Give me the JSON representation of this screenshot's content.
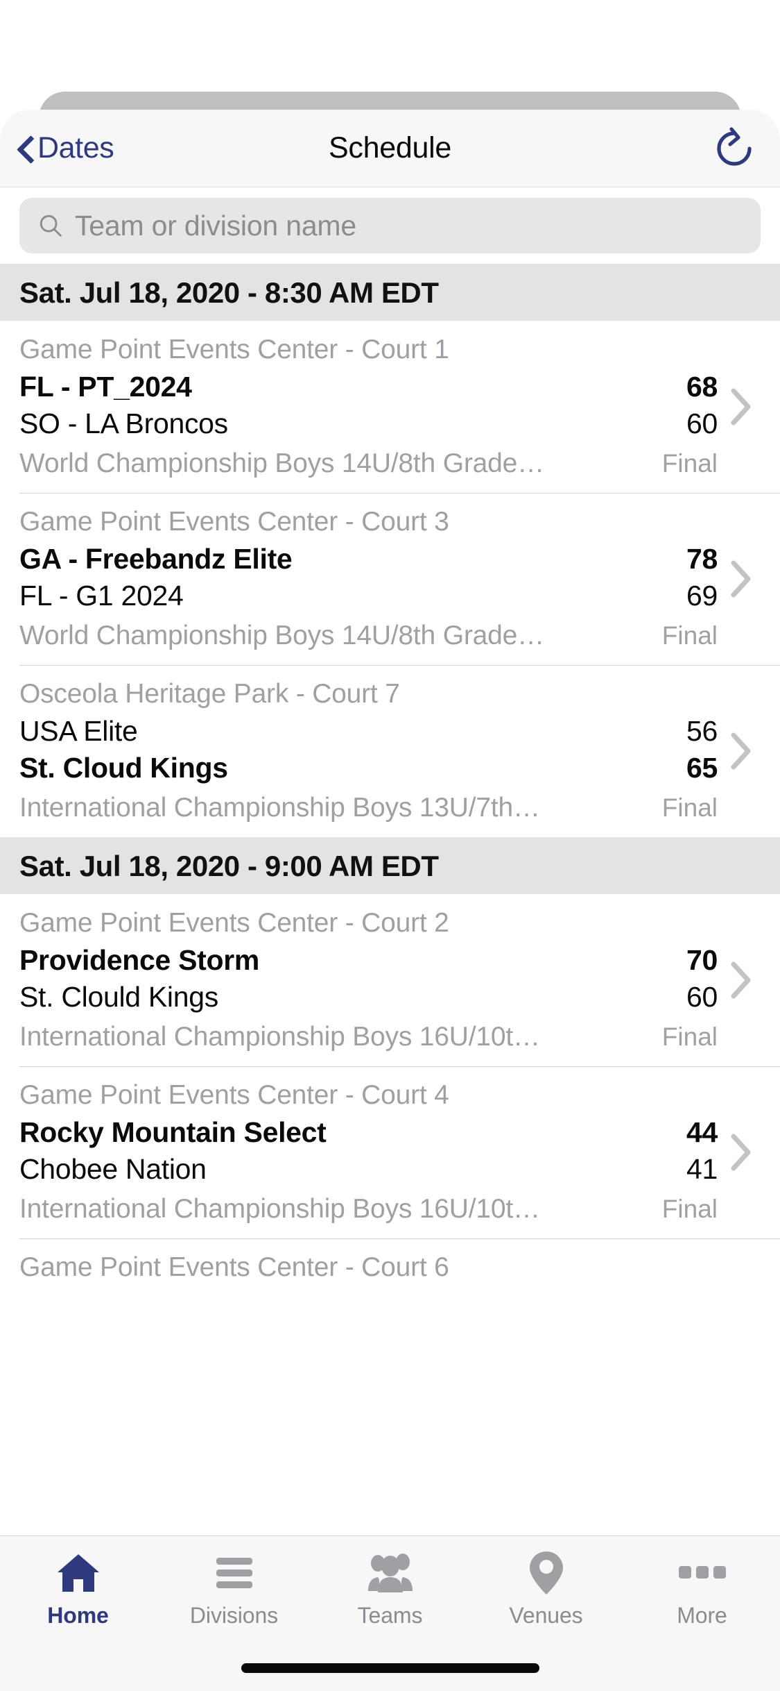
{
  "nav": {
    "back_label": "Dates",
    "title": "Schedule",
    "back_icon": "chevron-left-icon",
    "refresh_icon": "refresh-icon"
  },
  "search": {
    "placeholder": "Team or division name",
    "value": "",
    "icon": "search-icon"
  },
  "colors": {
    "accent": "#2e3a7d",
    "section_header_bg": "#e3e3e5",
    "secondary_text": "#a0a0a4",
    "search_bg": "#e6e6e8"
  },
  "sections": [
    {
      "header": "Sat. Jul 18, 2020 - 8:30 AM EDT",
      "games": [
        {
          "venue": "Game Point Events Center - Court 1",
          "away_team": "FL - PT_2024",
          "away_score": "68",
          "away_winner": true,
          "home_team": "SO - LA Broncos",
          "home_score": "60",
          "home_winner": false,
          "division": "World Championship Boys 14U/8th Grade…",
          "status": "Final"
        },
        {
          "venue": "Game Point Events Center - Court 3",
          "away_team": "GA - Freebandz Elite",
          "away_score": "78",
          "away_winner": true,
          "home_team": "FL - G1 2024",
          "home_score": "69",
          "home_winner": false,
          "division": "World Championship Boys 14U/8th Grade…",
          "status": "Final"
        },
        {
          "venue": "Osceola Heritage Park - Court 7",
          "away_team": "USA Elite",
          "away_score": "56",
          "away_winner": false,
          "home_team": "St. Cloud Kings",
          "home_score": "65",
          "home_winner": true,
          "division": "International Championship Boys 13U/7th…",
          "status": "Final"
        }
      ]
    },
    {
      "header": "Sat. Jul 18, 2020 - 9:00 AM EDT",
      "games": [
        {
          "venue": "Game Point Events Center - Court 2",
          "away_team": "Providence Storm",
          "away_score": "70",
          "away_winner": true,
          "home_team": "St. Clould Kings",
          "home_score": "60",
          "home_winner": false,
          "division": "International Championship Boys 16U/10t…",
          "status": "Final"
        },
        {
          "venue": "Game Point Events Center - Court 4",
          "away_team": "Rocky Mountain Select",
          "away_score": "44",
          "away_winner": true,
          "home_team": "Chobee Nation",
          "home_score": "41",
          "home_winner": false,
          "division": "International Championship Boys 16U/10t…",
          "status": "Final"
        },
        {
          "venue": "Game Point Events Center - Court 6",
          "away_team": "",
          "away_score": "",
          "away_winner": false,
          "home_team": "",
          "home_score": "",
          "home_winner": false,
          "division": "",
          "status": ""
        }
      ]
    }
  ],
  "tabbar": {
    "items": [
      {
        "label": "Home",
        "icon": "home-icon",
        "active": true
      },
      {
        "label": "Divisions",
        "icon": "list-icon",
        "active": false
      },
      {
        "label": "Teams",
        "icon": "people-icon",
        "active": false
      },
      {
        "label": "Venues",
        "icon": "map-pin-icon",
        "active": false
      },
      {
        "label": "More",
        "icon": "ellipsis-icon",
        "active": false
      }
    ]
  }
}
